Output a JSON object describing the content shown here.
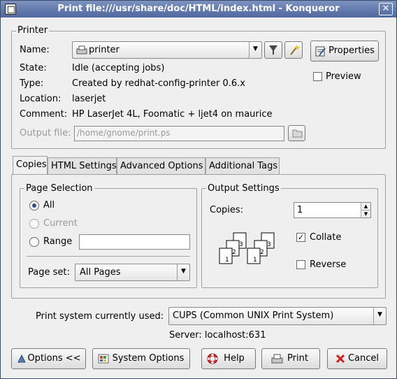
{
  "window": {
    "title": "Print file:///usr/share/doc/HTML/index.html - Konqueror"
  },
  "printer": {
    "group_title": "Printer",
    "name_label": "Name:",
    "name_value": "printer",
    "state_label": "State:",
    "state_value": "Idle (accepting jobs)",
    "type_label": "Type:",
    "type_value": "Created by redhat-config-printer 0.6.x",
    "location_label": "Location:",
    "location_value": "laserjet",
    "comment_label": "Comment:",
    "comment_value": "HP LaserJet 4L, Foomatic + ljet4 on maurice",
    "output_file_label": "Output file:",
    "output_file_value": "/home/gnome/print.ps",
    "properties_label": "Properties",
    "preview_label": "Preview"
  },
  "tabs": [
    "Copies",
    "HTML Settings",
    "Advanced Options",
    "Additional Tags"
  ],
  "page_selection": {
    "group_title": "Page Selection",
    "all_label": "All",
    "current_label": "Current",
    "range_label": "Range",
    "range_value": "",
    "page_set_label": "Page set:",
    "page_set_value": "All Pages"
  },
  "output_settings": {
    "group_title": "Output Settings",
    "copies_label": "Copies:",
    "copies_value": "1",
    "collate_label": "Collate",
    "reverse_label": "Reverse",
    "page_numbers": [
      "3",
      "2",
      "1",
      "3",
      "2",
      "1"
    ]
  },
  "print_system": {
    "label": "Print system currently used:",
    "value": "CUPS (Common UNIX Print System)",
    "server": "Server: localhost:631"
  },
  "buttons": {
    "options": "Options <<",
    "system_options": "System Options",
    "help": "Help",
    "print": "Print",
    "cancel": "Cancel"
  }
}
